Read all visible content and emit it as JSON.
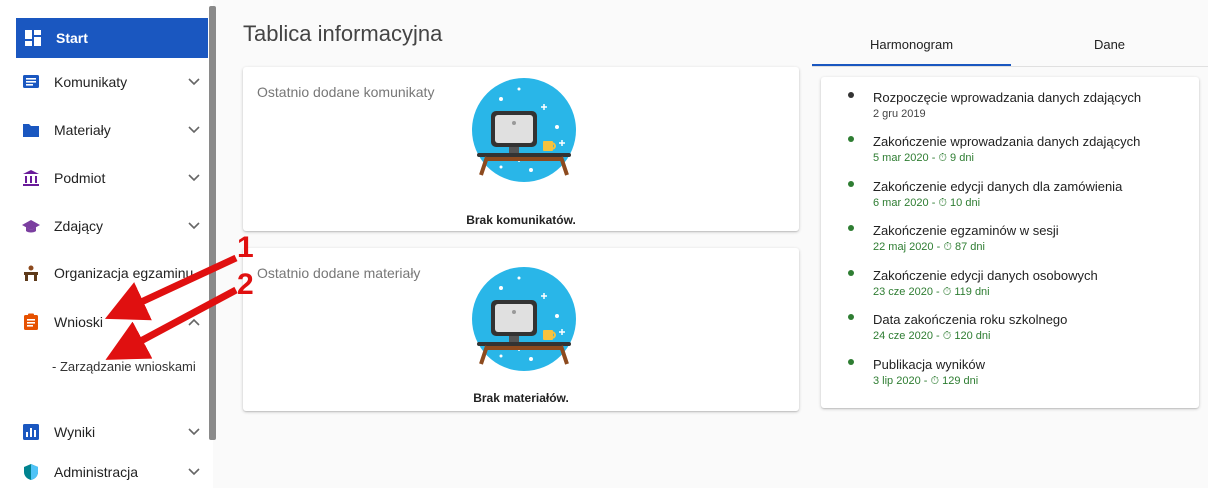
{
  "sidebar": {
    "items": [
      {
        "label": "Start",
        "icon": "dashboard-icon",
        "active": true
      },
      {
        "label": "Komunikaty",
        "icon": "message-icon"
      },
      {
        "label": "Materiały",
        "icon": "folder-icon"
      },
      {
        "label": "Podmiot",
        "icon": "institution-icon"
      },
      {
        "label": "Zdający",
        "icon": "graduation-cap-icon"
      },
      {
        "label": "Organizacja egzaminu",
        "icon": "desk-icon"
      },
      {
        "label": "Wnioski",
        "icon": "clipboard-icon",
        "expanded": true
      },
      {
        "label": "Wyniki",
        "icon": "bar-chart-icon"
      },
      {
        "label": "Administracja",
        "icon": "shield-icon"
      }
    ],
    "sub_items": [
      {
        "label": "- Zarządzanie wnioskami"
      }
    ]
  },
  "main": {
    "title": "Tablica informacyjna",
    "cards": [
      {
        "header": "Ostatnio dodane komunikaty",
        "empty": "Brak komunikatów."
      },
      {
        "header": "Ostatnio dodane materiały",
        "empty": "Brak materiałów."
      }
    ]
  },
  "right_panel": {
    "tabs": [
      {
        "label": "Harmonogram",
        "active": true
      },
      {
        "label": "Dane"
      }
    ],
    "timeline": [
      {
        "title": "Rozpoczęcie wprowadzania danych zdających",
        "sub": "2 gru 2019",
        "status": "past"
      },
      {
        "title": "Zakończenie wprowadzania danych zdających",
        "sub": "5 mar 2020 - ⏱ 9 dni",
        "status": "upcoming"
      },
      {
        "title": "Zakończenie edycji danych dla zamówienia",
        "sub": "6 mar 2020 - ⏱ 10 dni",
        "status": "upcoming"
      },
      {
        "title": "Zakończenie egzaminów w sesji",
        "sub": "22 maj 2020 - ⏱ 87 dni",
        "status": "upcoming"
      },
      {
        "title": "Zakończenie edycji danych osobowych",
        "sub": "23 cze 2020 - ⏱ 119 dni",
        "status": "upcoming"
      },
      {
        "title": "Data zakończenia roku szkolnego",
        "sub": "24 cze 2020 - ⏱ 120 dni",
        "status": "upcoming"
      },
      {
        "title": "Publikacja wyników",
        "sub": "3 lip 2020 - ⏱ 129 dni",
        "status": "upcoming"
      }
    ]
  },
  "annotations": {
    "one": "1",
    "two": "2"
  },
  "colors": {
    "primary": "#1a57c0",
    "upcoming": "#2e7d32",
    "past": "#333333",
    "annotation": "#e01010"
  }
}
